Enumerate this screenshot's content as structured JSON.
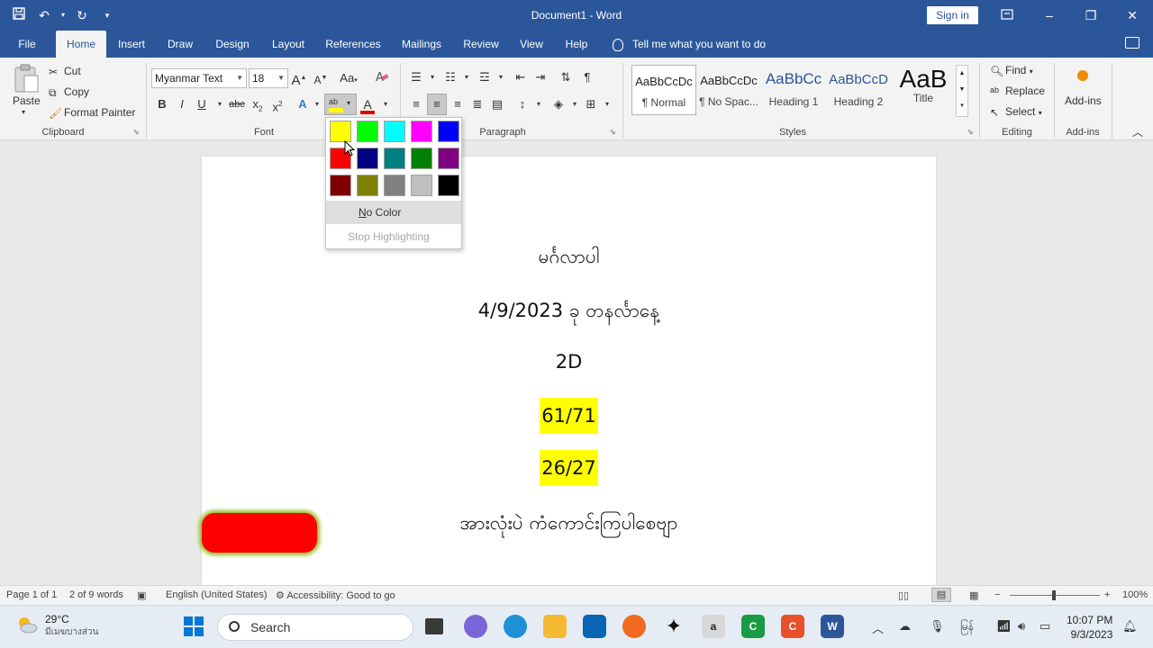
{
  "app": {
    "doc_title": "Document1  -  Word",
    "sign_in": "Sign in",
    "accent": "#2b579a"
  },
  "tabs": [
    "File",
    "Home",
    "Insert",
    "Draw",
    "Design",
    "Layout",
    "References",
    "Mailings",
    "Review",
    "View",
    "Help"
  ],
  "tell_me": "Tell me what you want to do",
  "clipboard": {
    "paste": "Paste",
    "cut": "Cut",
    "copy": "Copy",
    "format_painter": "Format Painter",
    "label": "Clipboard"
  },
  "font": {
    "name": "Myanmar Text",
    "size": "18",
    "label": "Font",
    "grow": "A",
    "shrink": "A",
    "case": "Aa",
    "bold": "B",
    "italic": "I",
    "underline": "U",
    "strike": "abc",
    "subscript": "x",
    "superscript": "x",
    "sub_mark": "2",
    "sup_mark": "2",
    "color_letter": "A",
    "highlight_letters": "ab"
  },
  "paragraph": {
    "label": "Paragraph"
  },
  "styles": {
    "label": "Styles",
    "items": [
      {
        "sample": "AaBbCcDc",
        "name": "¶ Normal"
      },
      {
        "sample": "AaBbCcDc",
        "name": "¶ No Spac..."
      },
      {
        "sample": "AaBbCc",
        "name": "Heading 1"
      },
      {
        "sample": "AaBbCcD",
        "name": "Heading 2"
      },
      {
        "sample": "AaB",
        "name": "Title"
      }
    ]
  },
  "editing": {
    "label": "Editing",
    "find": "Find",
    "replace": "Replace",
    "select": "Select"
  },
  "addins": {
    "button": "Add-ins",
    "label": "Add-ins"
  },
  "highlight_menu": {
    "colors": [
      "#ffff00",
      "#00ff00",
      "#00ffff",
      "#ff00ff",
      "#0000ff",
      "#ff0000",
      "#000080",
      "#008080",
      "#008000",
      "#800080",
      "#800000",
      "#808000",
      "#808080",
      "#c0c0c0",
      "#000000"
    ],
    "no_color_u": "N",
    "no_color_rest": "o Color",
    "stop": "Stop Highlighting"
  },
  "document": {
    "lines": [
      "မင်္ဂလာပါ",
      "4/9/2023 ခု တနင်္လာနေ့",
      "2D",
      "61/71",
      "26/27",
      "အားလုံးပဲ ကံကောင်းကြပါစေဗျာ"
    ],
    "highlight_color": "#ffff00"
  },
  "status": {
    "page": "Page 1 of 1",
    "words": "2 of 9 words",
    "language": "English (United States)",
    "accessibility": "Accessibility: Good to go",
    "zoom": "100%",
    "minus": "−",
    "plus": "+"
  },
  "taskbar": {
    "temp": "29°C",
    "weather_desc": "มีเมฆบางส่วน",
    "search": "Search",
    "time": "10:07 PM",
    "date": "9/3/2023",
    "lang": "မြန်"
  }
}
